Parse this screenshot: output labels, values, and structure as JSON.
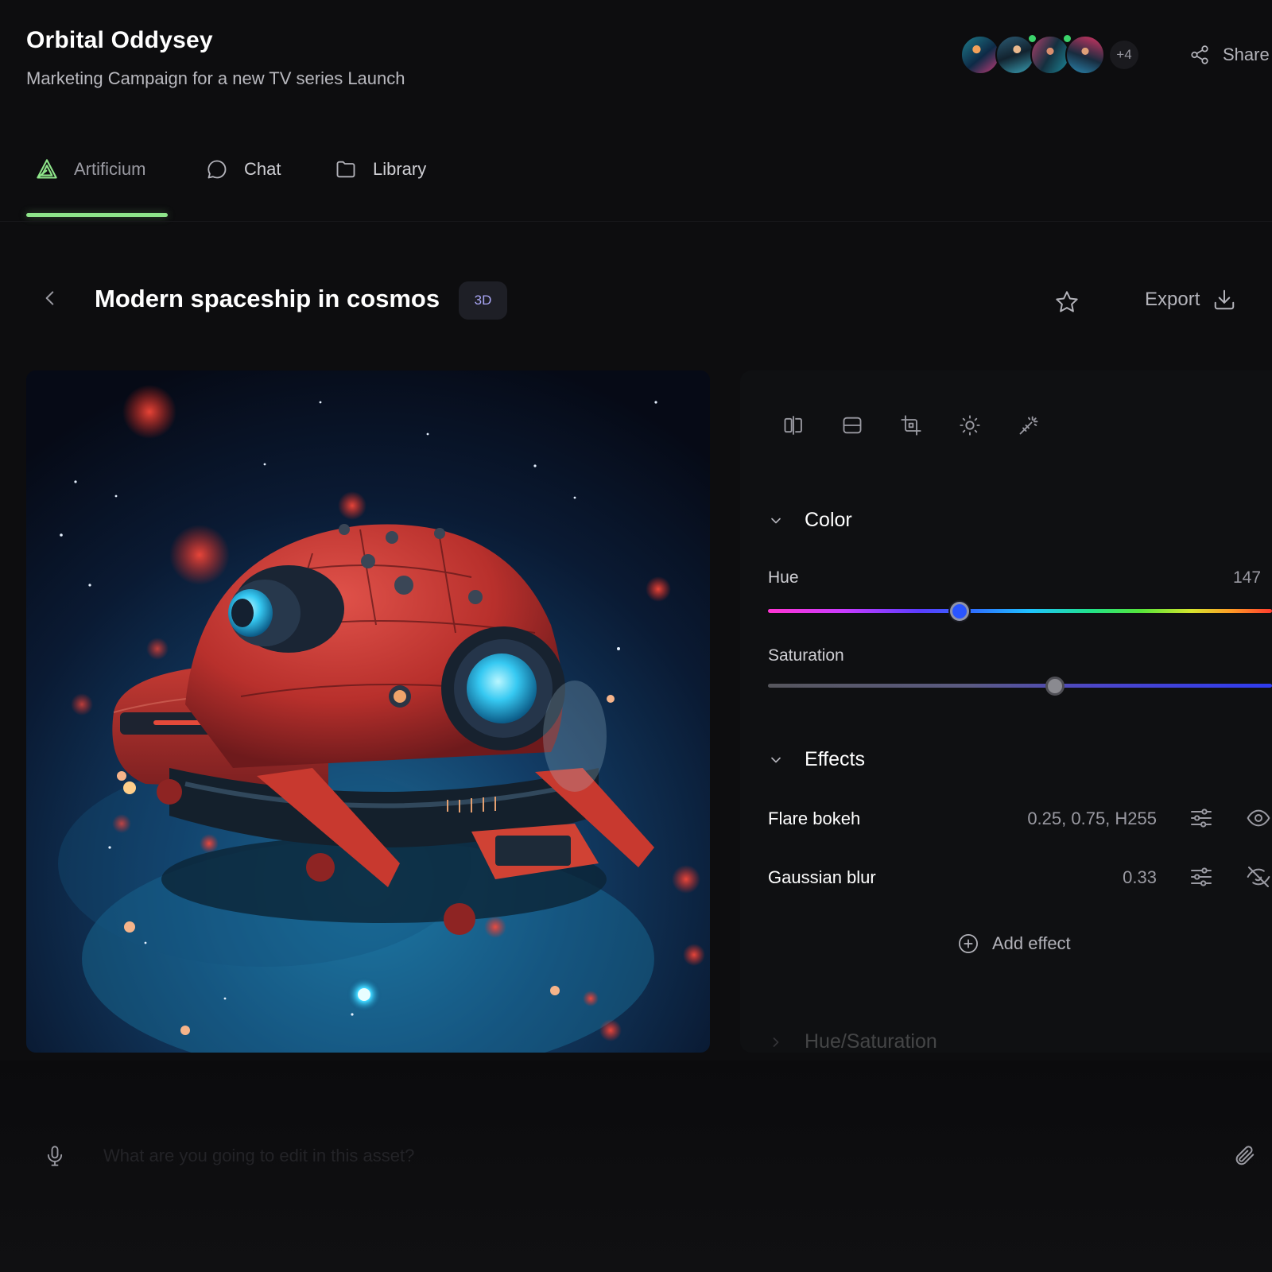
{
  "project": {
    "title": "Orbital Oddysey",
    "subtitle": "Marketing Campaign for a new TV series Launch"
  },
  "collaborators": {
    "avatars": [
      "avatar-1",
      "avatar-2",
      "avatar-3",
      "avatar-4"
    ],
    "more_count": "+4"
  },
  "header": {
    "share_label": "Share"
  },
  "tabs": [
    {
      "label": "Artificium",
      "icon": "artificium-logo-icon",
      "active": true
    },
    {
      "label": "Chat",
      "icon": "chat-bubble-icon",
      "active": false
    },
    {
      "label": "Library",
      "icon": "folder-icon",
      "active": false
    }
  ],
  "asset": {
    "title": "Modern spaceship in cosmos",
    "badge": "3D",
    "export_label": "Export"
  },
  "toolbar": {
    "tools": [
      "flip-horizontal-icon",
      "flip-vertical-icon",
      "crop-icon",
      "brightness-icon",
      "magic-wand-icon"
    ]
  },
  "panel": {
    "color_section": {
      "title": "Color",
      "hue": {
        "label": "Hue",
        "value": "147",
        "position": 0.38
      },
      "saturation": {
        "label": "Saturation",
        "position": 0.57
      }
    },
    "effects_section": {
      "title": "Effects",
      "effects": [
        {
          "name": "Flare bokeh",
          "value": "0.25, 0.75, H255",
          "visible": true
        },
        {
          "name": "Gaussian blur",
          "value": "0.33",
          "visible": false
        }
      ],
      "add_label": "Add effect"
    },
    "hue_saturation_section": {
      "title": "Hue/Saturation"
    }
  },
  "prompt": {
    "placeholder": "What are you going to edit in this asset?"
  },
  "colors": {
    "accent": "#8ee58a",
    "background": "#0d0d0f",
    "badge_text": "#a9a6f5"
  }
}
